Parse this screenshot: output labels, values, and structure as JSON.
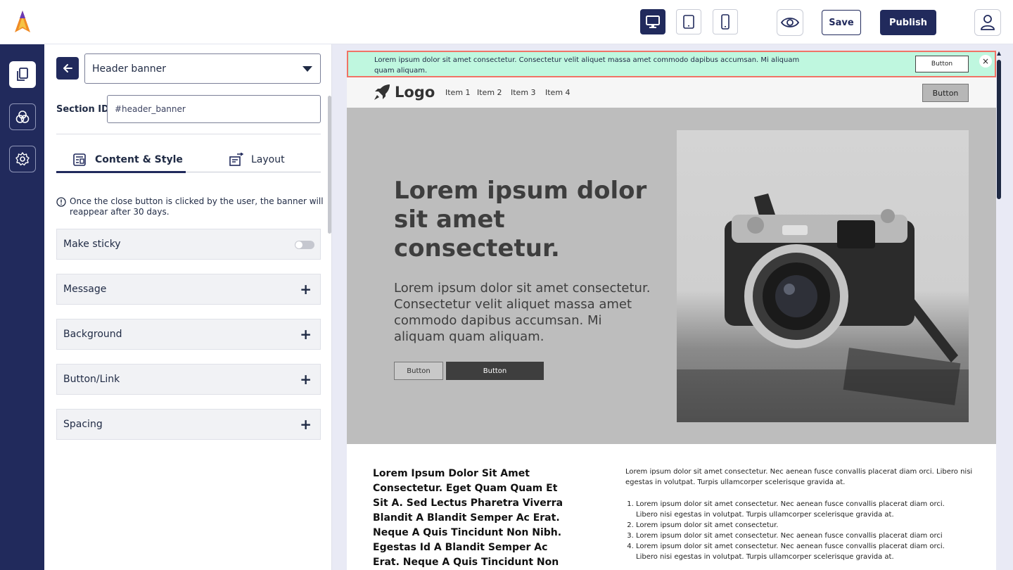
{
  "topbar": {
    "save_label": "Save",
    "publish_label": "Publish"
  },
  "panel": {
    "section_select": "Header banner",
    "section_id_label": "Section ID",
    "section_id_value": "#header_banner",
    "tabs": [
      {
        "label": "Content & Style",
        "active": true
      },
      {
        "label": "Layout",
        "active": false
      }
    ],
    "info_text": "Once the close button is clicked by the user, the banner will reappear after 30 days.",
    "make_sticky_label": "Make sticky",
    "make_sticky_on": false,
    "accordions": [
      "Message",
      "Background",
      "Button/Link",
      "Spacing"
    ]
  },
  "preview": {
    "banner": {
      "message": "Lorem ipsum dolor sit amet consectetur. Consectetur velit aliquet massa amet commodo dapibus accumsan. Mi aliquam quam aliquam.",
      "button_label": "Button",
      "close_label": "×"
    },
    "nav": {
      "logo": "Logo",
      "items": [
        "Item 1",
        "Item 2",
        "Item 3",
        "Item 4"
      ],
      "button_label": "Button"
    },
    "hero": {
      "heading": "Lorem ipsum dolor sit amet consectetur.",
      "subheading": "Lorem ipsum dolor sit amet consectetur. Consectetur velit aliquet massa amet commodo dapibus accumsan. Mi aliquam quam aliquam.",
      "button1": "Button",
      "button2": "Button"
    },
    "content": {
      "left": "Lorem Ipsum Dolor Sit Amet Consectetur. Eget Quam Quam Et Sit A. Sed Lectus Pharetra Viverra Blandit A Blandit Semper Ac Erat. Neque A Quis Tincidunt Non Nibh. Egestas Id  A Blandit Semper Ac Erat. Neque A Quis Tincidunt Non Nibh.",
      "right": "Lorem ipsum dolor sit amet consectetur. Nec aenean fusce convallis placerat diam orci. Libero nisi egestas in volutpat. Turpis ullamcorper scelerisque gravida at.",
      "list": [
        "Lorem ipsum dolor sit amet consectetur. Nec aenean fusce convallis placerat diam orci. Libero nisi egestas in volutpat. Turpis ullamcorper scelerisque gravida at.",
        "Lorem ipsum dolor sit amet consectetur.",
        "Lorem ipsum dolor sit amet consectetur. Nec aenean fusce convallis placerat diam orci",
        "Lorem ipsum dolor sit amet consectetur. Nec aenean fusce convallis placerat diam orci. Libero nisi egestas in volutpat. Turpis ullamcorper scelerisque gravida at."
      ]
    }
  },
  "colors": {
    "brand_navy": "#212a5c",
    "banner_bg": "#bff7df",
    "banner_outline": "#f07366",
    "hero_bg": "#bdbdbd"
  },
  "icons": [
    "app-logo-icon",
    "desktop-icon",
    "tablet-icon",
    "mobile-icon",
    "eye-icon",
    "user-icon",
    "pages-icon",
    "theme-icon",
    "settings-icon",
    "arrow-left-icon",
    "chevron-down-icon",
    "content-style-icon",
    "layout-icon",
    "info-icon",
    "plus-icon",
    "rocket-icon",
    "close-icon"
  ]
}
